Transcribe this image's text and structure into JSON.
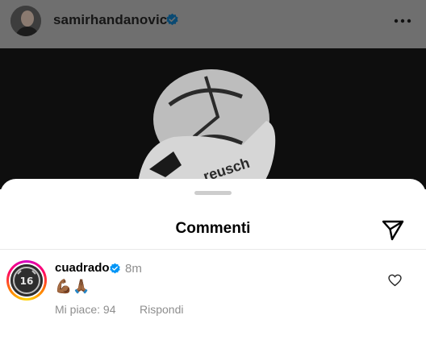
{
  "post": {
    "username": "samirhandanovic",
    "verified": true,
    "icons": {
      "avatar": "profile-photo",
      "verified": "verified-badge-icon",
      "more": "more-options-icon"
    },
    "image_brand_text": "reusch"
  },
  "sheet": {
    "title": "Commenti",
    "share_icon": "paper-plane-icon"
  },
  "comments": [
    {
      "username": "cuadrado",
      "verified": true,
      "time": "8m",
      "text": "💪🏾🙏🏾",
      "likes_label": "Mi piace: 94",
      "reply_label": "Rispondi",
      "like_icon": "heart-outline-icon"
    }
  ],
  "colors": {
    "verified_blue": "#0095f6",
    "secondary_text": "#8e8e8e",
    "dim_overlay": "#6f6f6f"
  }
}
